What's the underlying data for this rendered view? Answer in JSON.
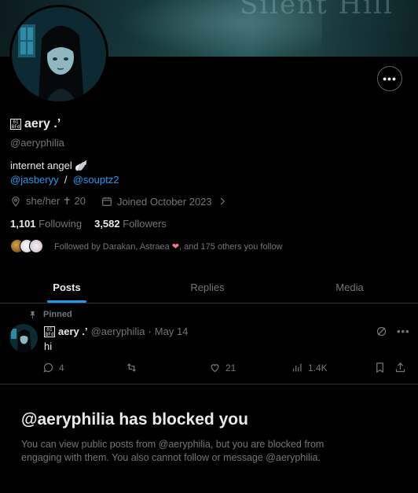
{
  "banner": {
    "text": "Silent Hill"
  },
  "profile": {
    "display_name": "aery .’",
    "flag_glyph": "01 BFd",
    "handle": "@aeryphilia",
    "bio": "internet angel 🪽",
    "bio_link_1": "@jasberyy",
    "bio_separator": "/",
    "bio_link_2": "@souptz2",
    "pronouns": "she/her ✝ 20",
    "joined": "Joined October 2023",
    "following_count": "1,101",
    "following_label": "Following",
    "followers_count": "3,582",
    "followers_label": "Followers",
    "followed_by_prefix": "Followed by Darakan, Astraea ",
    "followed_by_heart": "❤",
    "followed_by_suffix": ", and 175 others you follow"
  },
  "tabs": [
    {
      "label": "Posts"
    },
    {
      "label": "Replies"
    },
    {
      "label": "Media"
    }
  ],
  "post": {
    "pinned_label": "Pinned",
    "name": "aery .’",
    "handle": "@aeryphilia",
    "dot": "·",
    "date": "May 14",
    "text": "hi",
    "replies": "4",
    "likes": "21",
    "views": "1.4K"
  },
  "blocked": {
    "title": "@aeryphilia has blocked you",
    "text": "You can view public posts from @aeryphilia, but you are blocked from engaging with them. You also cannot follow or message @aeryphilia."
  },
  "colors": {
    "accent": "#1d9bf0",
    "muted": "#71767b",
    "text": "#e7e9ea",
    "background": "#000000"
  }
}
